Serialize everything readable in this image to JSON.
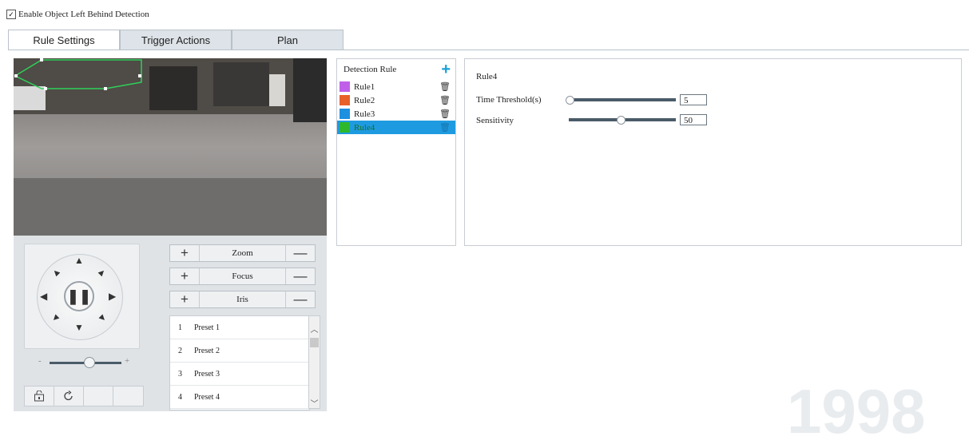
{
  "enable_detection": {
    "label": "Enable Object Left Behind Detection",
    "checked": true
  },
  "tabs": [
    {
      "label": "Rule Settings",
      "active": true
    },
    {
      "label": "Trigger Actions",
      "active": false
    },
    {
      "label": "Plan",
      "active": false
    }
  ],
  "ptz": {
    "speed_minus": "-",
    "speed_plus": "+",
    "controls": [
      {
        "label": "Zoom",
        "plus": "+",
        "minus": "—"
      },
      {
        "label": "Focus",
        "plus": "+",
        "minus": "—"
      },
      {
        "label": "Iris",
        "plus": "+",
        "minus": "—"
      }
    ],
    "presets": [
      {
        "num": "1",
        "name": "Preset 1"
      },
      {
        "num": "2",
        "name": "Preset 2"
      },
      {
        "num": "3",
        "name": "Preset 3"
      },
      {
        "num": "4",
        "name": "Preset 4"
      }
    ]
  },
  "detection_rules": {
    "header": "Detection Rule",
    "add_icon": "plus-icon",
    "rules": [
      {
        "label": "Rule1",
        "color": "#c060e8",
        "selected": false
      },
      {
        "label": "Rule2",
        "color": "#e8602a",
        "selected": false
      },
      {
        "label": "Rule3",
        "color": "#1e90e0",
        "selected": false
      },
      {
        "label": "Rule4",
        "color": "#2eb82e",
        "selected": true
      }
    ]
  },
  "settings": {
    "title": "Rule4",
    "time_threshold": {
      "label": "Time Threshold(s)",
      "value": "5",
      "min": 5,
      "max": 3600
    },
    "sensitivity": {
      "label": "Sensitivity",
      "value": "50",
      "min": 0,
      "max": 100
    }
  },
  "colors": {
    "accent": "#1e9be0",
    "tab_inactive": "#dde3e8",
    "panel_bg": "#dfe3e6"
  }
}
